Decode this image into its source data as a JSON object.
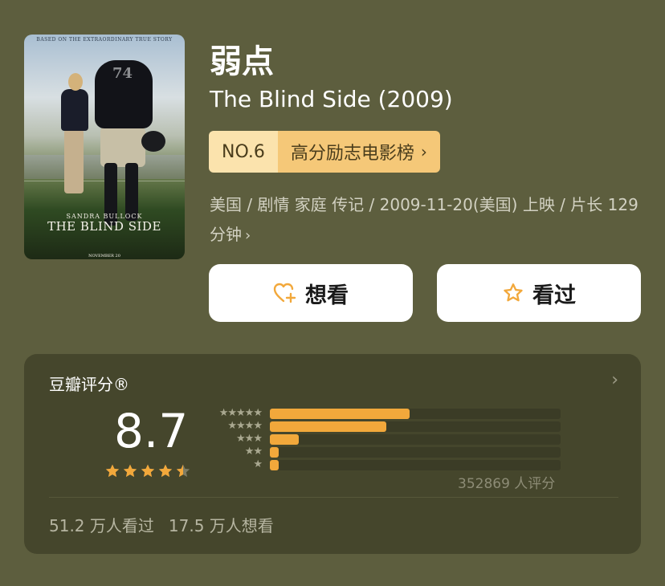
{
  "poster": {
    "tagline": "BASED ON THE EXTRAORDINARY TRUE STORY",
    "actor": "SANDRA BULLOCK",
    "title": "THE BLIND SIDE",
    "date": "NOVEMBER 20",
    "jersey": "74"
  },
  "movie": {
    "title_zh": "弱点",
    "title_en": "The Blind Side (2009)"
  },
  "rank": {
    "number": "NO.6",
    "list_name": "高分励志电影榜",
    "arrow": "›"
  },
  "meta": {
    "line": "美国 / 剧情 家庭 传记 / 2009-11-20(美国) 上映 / 片长 129 分钟",
    "arrow": "›"
  },
  "buttons": {
    "want_label": "想看",
    "seen_label": "看过"
  },
  "rating": {
    "section_title": "豆瓣评分®",
    "chevron": "›",
    "score": "8.7",
    "stars": 4.5,
    "total": "352869 人评分",
    "distribution": [
      {
        "stars": "★★★★★",
        "ratio": 0.48
      },
      {
        "stars": "★★★★",
        "ratio": 0.4
      },
      {
        "stars": "★★★",
        "ratio": 0.1
      },
      {
        "stars": "★★",
        "ratio": 0.03
      },
      {
        "stars": "★",
        "ratio": 0.03
      }
    ],
    "seen_count": "51.2 万人看过",
    "want_count": "17.5 万人想看"
  },
  "colors": {
    "accent": "#f2a83b",
    "background": "#5d5e3e",
    "card": "#45462c"
  }
}
